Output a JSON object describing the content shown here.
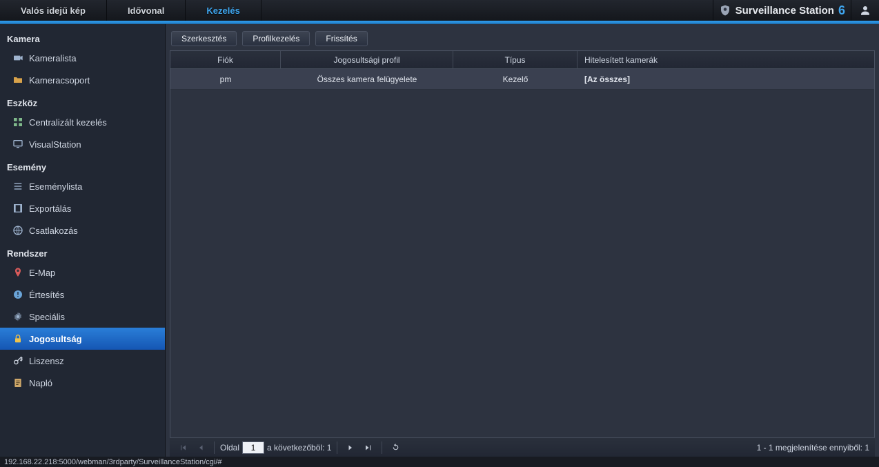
{
  "topnav": {
    "items": [
      {
        "label": "Valós idejű kép"
      },
      {
        "label": "Idővonal"
      },
      {
        "label": "Kezelés"
      }
    ]
  },
  "brand": {
    "name": "Surveillance Station",
    "version": "6"
  },
  "sidebar": {
    "groups": [
      {
        "title": "Kamera",
        "items": [
          {
            "label": "Kameralista",
            "icon": "camera"
          },
          {
            "label": "Kameracsoport",
            "icon": "folder"
          }
        ]
      },
      {
        "title": "Eszköz",
        "items": [
          {
            "label": "Centralizált kezelés",
            "icon": "grid"
          },
          {
            "label": "VisualStation",
            "icon": "monitor"
          }
        ]
      },
      {
        "title": "Esemény",
        "items": [
          {
            "label": "Eseménylista",
            "icon": "list"
          },
          {
            "label": "Exportálás",
            "icon": "film"
          },
          {
            "label": "Csatlakozás",
            "icon": "globe"
          }
        ]
      },
      {
        "title": "Rendszer",
        "items": [
          {
            "label": "E-Map",
            "icon": "pin"
          },
          {
            "label": "Értesítés",
            "icon": "alert"
          },
          {
            "label": "Speciális",
            "icon": "gear"
          },
          {
            "label": "Jogosultság",
            "icon": "lock"
          },
          {
            "label": "Liszensz",
            "icon": "key"
          },
          {
            "label": "Napló",
            "icon": "log"
          }
        ]
      }
    ]
  },
  "toolbar": {
    "edit": "Szerkesztés",
    "profile": "Profilkezelés",
    "refresh": "Frissítés"
  },
  "table": {
    "headers": {
      "account": "Fiók",
      "profile": "Jogosultsági profil",
      "type": "Típus",
      "cameras": "Hitelesített kamerák"
    },
    "rows": [
      {
        "account": "pm",
        "profile": "Összes kamera felügyelete",
        "type": "Kezelő",
        "cameras": "[Az összes]"
      }
    ]
  },
  "pager": {
    "page_label": "Oldal",
    "current": "1",
    "of_text": "a következőböl: 1",
    "summary": "1 - 1 megjelenítése ennyiből: 1"
  },
  "statusbar": {
    "text": "192.168.22.218:5000/webman/3rdparty/SurveillanceStation/cgi/#"
  }
}
